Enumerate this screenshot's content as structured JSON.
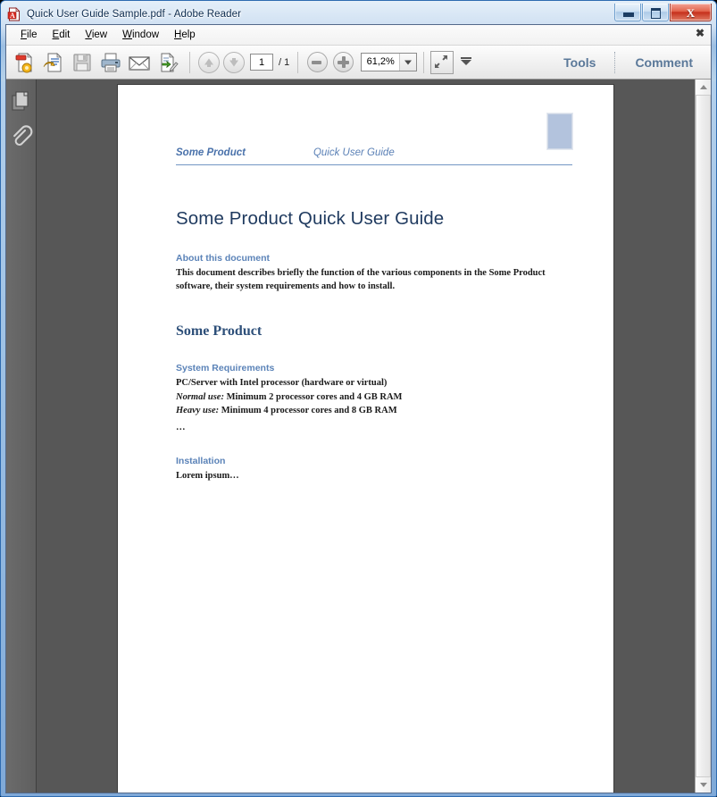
{
  "window": {
    "title": "Quick User Guide Sample.pdf - Adobe Reader",
    "app_icon": "adobe-reader-icon",
    "minimize_label": "Minimize",
    "maximize_label": "Maximize",
    "close_label": "X"
  },
  "menu": {
    "items": [
      {
        "label": "File",
        "accel": "F",
        "rest": "ile"
      },
      {
        "label": "Edit",
        "accel": "E",
        "rest": "dit"
      },
      {
        "label": "View",
        "accel": "V",
        "rest": "iew"
      },
      {
        "label": "Window",
        "accel": "W",
        "rest": "indow"
      },
      {
        "label": "Help",
        "accel": "H",
        "rest": "elp"
      }
    ],
    "close_glyph": "✖"
  },
  "toolbar": {
    "icons": [
      {
        "name": "create-pdf-icon",
        "title": "Create PDF"
      },
      {
        "name": "open-recent-icon",
        "title": "Open"
      },
      {
        "name": "save-icon",
        "title": "Save"
      },
      {
        "name": "print-icon",
        "title": "Print"
      },
      {
        "name": "email-icon",
        "title": "Email"
      },
      {
        "name": "share-sign-icon",
        "title": "Sign / Share"
      }
    ],
    "previous_page_label": "Previous Page",
    "next_page_label": "Next Page",
    "page_number": "1",
    "page_total": "/ 1",
    "zoom_out_label": "Zoom Out",
    "zoom_in_label": "Zoom In",
    "zoom_value": "61,2%",
    "fit_label": "Fit Page",
    "tools_label": "Tools",
    "comment_label": "Comment"
  },
  "navigation_rail": {
    "items": [
      {
        "name": "page-thumbnails-icon",
        "label": "Page Thumbnails"
      },
      {
        "name": "attachments-icon",
        "label": "Attachments"
      }
    ]
  },
  "document": {
    "running_header": {
      "left": "Some Product",
      "center": "Quick User Guide",
      "logo_placeholder": "logo-placeholder"
    },
    "title": "Some Product Quick User Guide",
    "sections": [
      {
        "heading": "About this document",
        "heading_level": "sub",
        "paragraphs": [
          "This document describes briefly the function of the various components in the Some Product software, their system requirements and how to install."
        ]
      },
      {
        "heading": "Some Product",
        "heading_level": "h2",
        "paragraphs": []
      },
      {
        "heading": "System Requirements",
        "heading_level": "sub",
        "lines": [
          {
            "label": "",
            "text": "PC/Server with Intel processor (hardware or virtual)"
          },
          {
            "label": "Normal use:",
            "text": " Minimum 2 processor cores and 4 GB RAM"
          },
          {
            "label": "Heavy use:",
            "text": " Minimum 4 processor cores and 8 GB RAM"
          }
        ],
        "ellipsis": "…"
      },
      {
        "heading": "Installation",
        "heading_level": "sub",
        "paragraphs": [
          "Lorem ipsum…"
        ]
      }
    ]
  },
  "scrollbar": {
    "up_label": "Scroll Up",
    "down_label": "Scroll Down",
    "thumb_label": "Vertical Scroll Thumb"
  },
  "colors": {
    "accent_blue": "#4a72ab",
    "title_navy": "#1f3a5f",
    "heading_blue": "#5b83b8",
    "h2_blue": "#2d4f79",
    "toolbar_text": "#5a7899",
    "doc_bg": "#575757",
    "logo_fill": "#b3c3dd"
  }
}
